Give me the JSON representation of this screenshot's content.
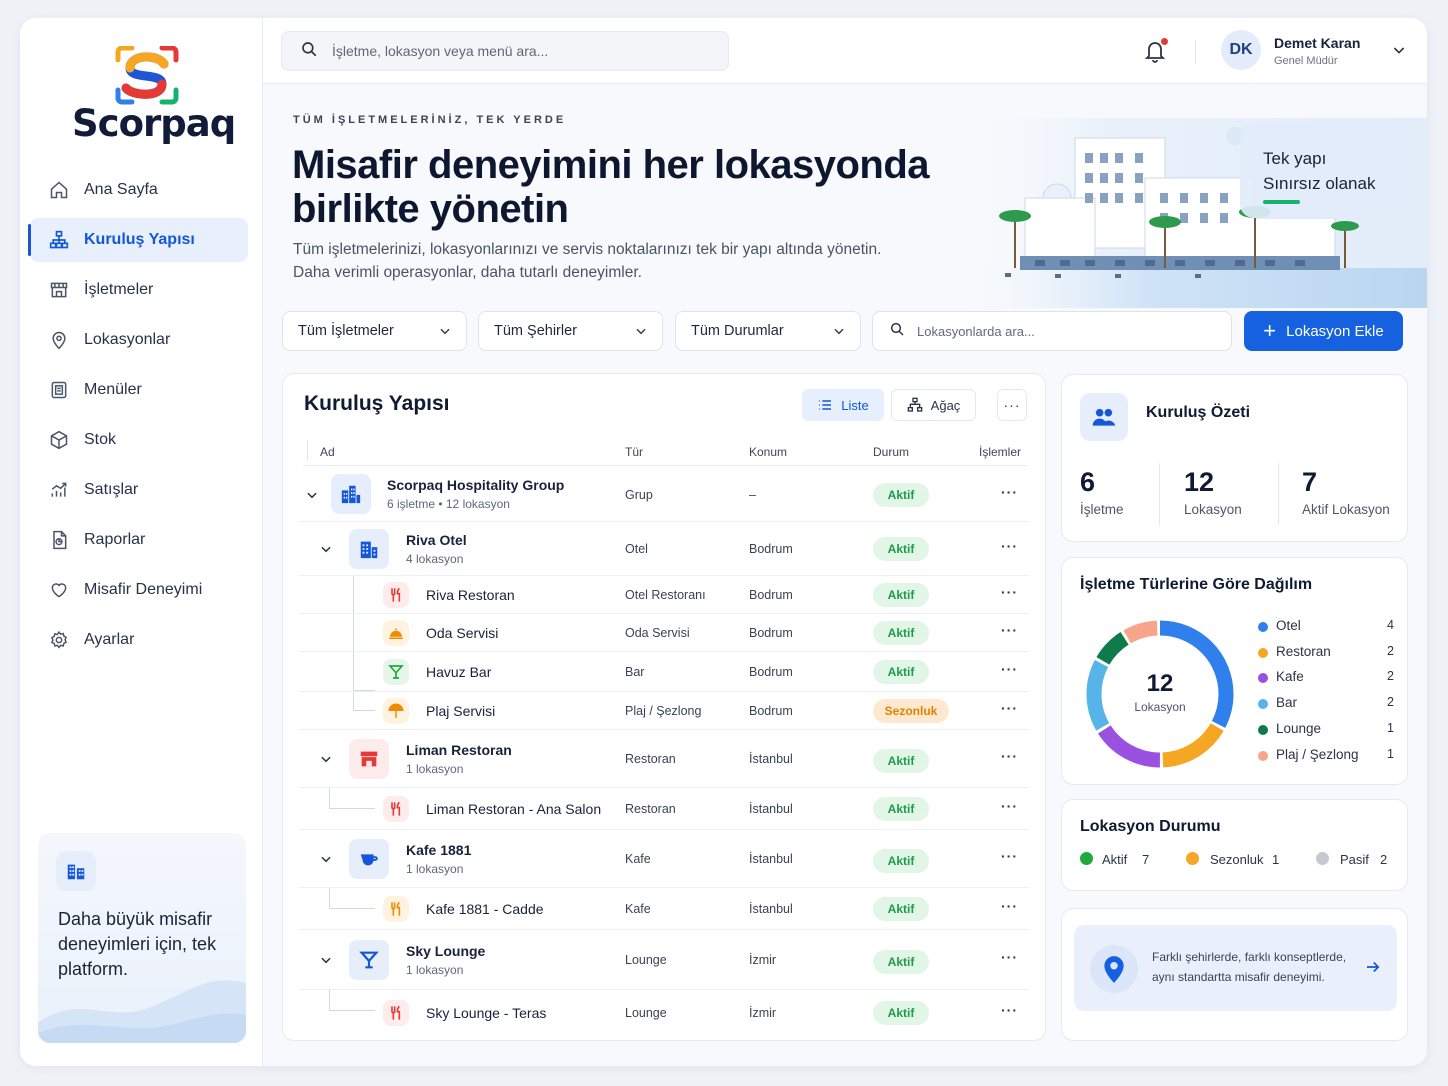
{
  "brand": {
    "name": "Scorpaq"
  },
  "sidebar": {
    "items": [
      {
        "label": "Ana Sayfa",
        "icon": "home-icon"
      },
      {
        "label": "Kuruluş Yapısı",
        "icon": "org-tree-icon",
        "active": true
      },
      {
        "label": "İşletmeler",
        "icon": "store-icon"
      },
      {
        "label": "Lokasyonlar",
        "icon": "location-pin-icon"
      },
      {
        "label": "Menüler",
        "icon": "menu-book-icon"
      },
      {
        "label": "Stok",
        "icon": "box-icon"
      },
      {
        "label": "Satışlar",
        "icon": "chart-up-icon"
      },
      {
        "label": "Raporlar",
        "icon": "report-icon"
      },
      {
        "label": "Misafir Deneyimi",
        "icon": "heart-icon"
      },
      {
        "label": "Ayarlar",
        "icon": "gear-icon"
      }
    ],
    "promo_text": "Daha büyük misafir deneyimleri için, tek platform."
  },
  "topbar": {
    "search_placeholder": "İşletme, lokasyon veya menü ara...",
    "user": {
      "initials": "DK",
      "name": "Demet Karan",
      "role": "Genel Müdür"
    }
  },
  "hero": {
    "eyebrow": "TÜM İŞLETMELERİNİZ, TEK YERDE",
    "title": "Misafir deneyimini her lokasyonda birlikte yönetin",
    "subtitle_line1": "Tüm işletmelerinizi, lokasyonlarınızı ve servis noktalarınızı tek bir yapı altında yönetin.",
    "subtitle_line2": "Daha verimli operasyonlar, daha tutarlı deneyimler.",
    "card_line1": "Tek yapı",
    "card_line2": "Sınırsız olanak"
  },
  "filters": {
    "business": "Tüm İşletmeler",
    "city": "Tüm Şehirler",
    "status": "Tüm Durumlar",
    "search_placeholder": "Lokasyonlarda ara...",
    "add_button": "Lokasyon Ekle"
  },
  "tree": {
    "title": "Kuruluş Yapısı",
    "view_list": "Liste",
    "view_tree": "Ağaç",
    "columns": {
      "name": "Ad",
      "type": "Tür",
      "location": "Konum",
      "status": "Durum",
      "actions": "İşlemler"
    },
    "rows": [
      {
        "name": "Scorpaq Hospitality Group",
        "meta": "6 işletme • 12 lokasyon",
        "type": "Grup",
        "location": "–",
        "status": "Aktif"
      },
      {
        "name": "Riva Otel",
        "meta": "4 lokasyon",
        "type": "Otel",
        "location": "Bodrum",
        "status": "Aktif"
      },
      {
        "name": "Riva Restoran",
        "type": "Otel Restoranı",
        "location": "Bodrum",
        "status": "Aktif"
      },
      {
        "name": "Oda Servisi",
        "type": "Oda Servisi",
        "location": "Bodrum",
        "status": "Aktif"
      },
      {
        "name": "Havuz Bar",
        "type": "Bar",
        "location": "Bodrum",
        "status": "Aktif"
      },
      {
        "name": "Plaj Servisi",
        "type": "Plaj / Şezlong",
        "location": "Bodrum",
        "status": "Sezonluk"
      },
      {
        "name": "Liman Restoran",
        "meta": "1 lokasyon",
        "type": "Restoran",
        "location": "İstanbul",
        "status": "Aktif"
      },
      {
        "name": "Liman Restoran - Ana Salon",
        "type": "Restoran",
        "location": "İstanbul",
        "status": "Aktif"
      },
      {
        "name": "Kafe 1881",
        "meta": "1 lokasyon",
        "type": "Kafe",
        "location": "İstanbul",
        "status": "Aktif"
      },
      {
        "name": "Kafe 1881 - Cadde",
        "type": "Kafe",
        "location": "İstanbul",
        "status": "Aktif"
      },
      {
        "name": "Sky Lounge",
        "meta": "1 lokasyon",
        "type": "Lounge",
        "location": "İzmir",
        "status": "Aktif"
      },
      {
        "name": "Sky Lounge - Teras",
        "type": "Lounge",
        "location": "İzmir",
        "status": "Aktif"
      }
    ],
    "actions_glyph": "···"
  },
  "summary": {
    "title": "Kuruluş Özeti",
    "stats": [
      {
        "value": "6",
        "label": "İşletme"
      },
      {
        "value": "12",
        "label": "Lokasyon"
      },
      {
        "value": "7",
        "label": "Aktif Lokasyon"
      }
    ]
  },
  "distribution": {
    "title": "İşletme Türlerine Göre Dağılım",
    "center_value": "12",
    "center_label": "Lokasyon",
    "legend": [
      {
        "label": "Otel",
        "value": "4",
        "color": "#2f80ed"
      },
      {
        "label": "Restoran",
        "value": "2",
        "color": "#f5a623"
      },
      {
        "label": "Kafe",
        "value": "2",
        "color": "#9b51e0"
      },
      {
        "label": "Bar",
        "value": "2",
        "color": "#56b4e9"
      },
      {
        "label": "Lounge",
        "value": "1",
        "color": "#0f7a4a"
      },
      {
        "label": "Plaj / Şezlong",
        "value": "1",
        "color": "#f7a58a"
      }
    ]
  },
  "status_card": {
    "title": "Lokasyon Durumu",
    "items": [
      {
        "label": "Aktif",
        "value": "7",
        "color": "#1faa3e"
      },
      {
        "label": "Sezonluk",
        "value": "1",
        "color": "#f5a623"
      },
      {
        "label": "Pasif",
        "value": "2",
        "color": "#c4c8cf"
      }
    ]
  },
  "cta": {
    "text": "Farklı şehirlerde, farklı konseptlerde, aynı standartta misafir deneyimi."
  },
  "colors": {
    "accent": "#1661e0",
    "active_bg": "#e1f6e7",
    "active_text": "#1f9a4a",
    "seasonal_bg": "#fde9cf",
    "seasonal_text": "#e48100"
  }
}
